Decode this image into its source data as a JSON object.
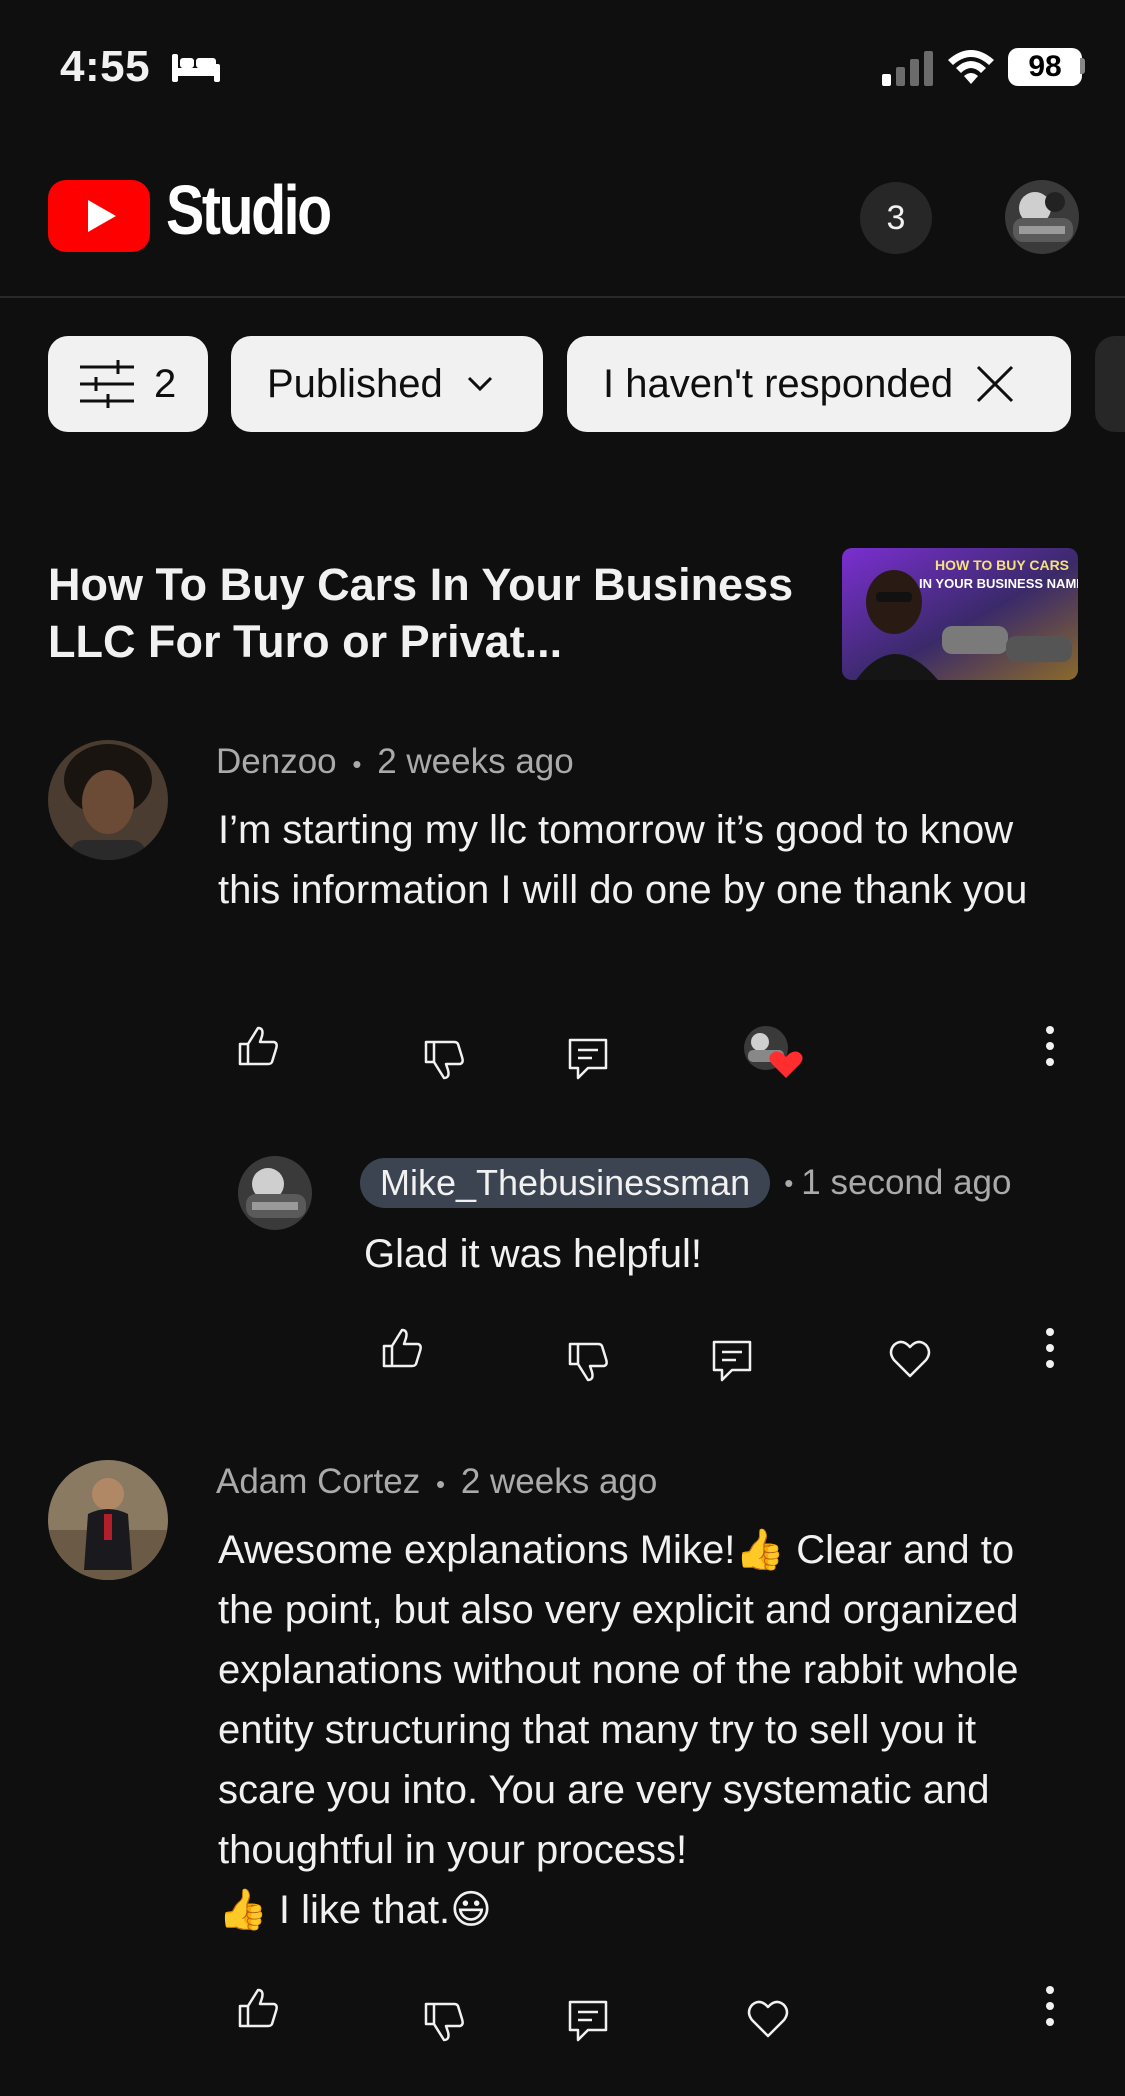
{
  "status_bar": {
    "time": "4:55",
    "battery": "98"
  },
  "header": {
    "app_name": "Studio",
    "notification_count": "3"
  },
  "filters": {
    "filter_count": "2",
    "published_label": "Published",
    "responded_label": "I haven't responded"
  },
  "video": {
    "title": "How To Buy Cars In Your Business LLC For Turo or Privat...",
    "thumbnail_text_line1": "HOW TO BUY CARS",
    "thumbnail_text_line2": "IN YOUR BUSINESS NAME"
  },
  "comments": [
    {
      "author": "Denzoo",
      "time": "2 weeks ago",
      "text": "I’m starting my llc tomorrow it’s good to know this information I will do one by one thank you",
      "hearted": true,
      "reply": {
        "author": "Mike_Thebusinessman",
        "time": "1 second ago",
        "text": "Glad it was helpful!"
      }
    },
    {
      "author": "Adam Cortez",
      "time": "2 weeks ago",
      "text_part1": "Awesome explanations Mike!",
      "text_part2": " Clear and to the point, but also very explicit and organized explanations without none of the rabbit whole entity structuring that many try to sell you it scare you into. You are very systematic and thoughtful in your process!",
      "text_part3": " I like that.",
      "emoji_thumbs": "👍",
      "emoji_smile": "😃"
    }
  ],
  "meta_separator": "•"
}
